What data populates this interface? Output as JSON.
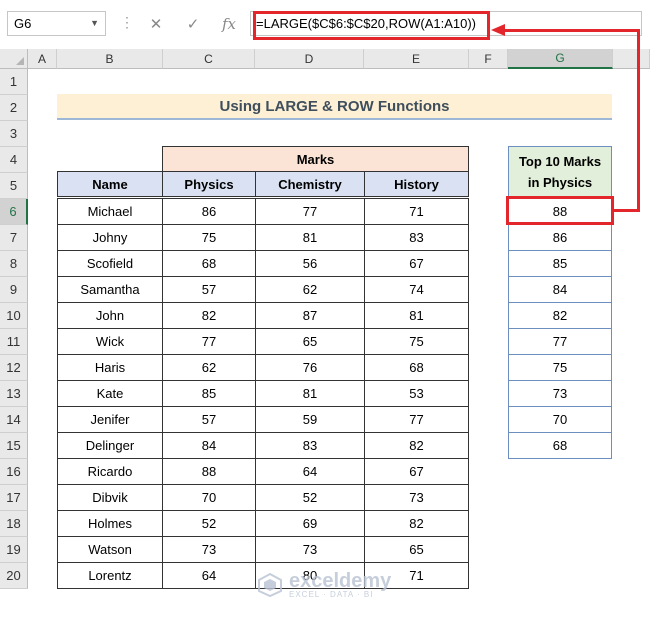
{
  "formula_bar": {
    "name_box": "G6",
    "cancel_icon": "✕",
    "enter_icon": "✓",
    "fx_label": "fx",
    "formula": "=LARGE($C$6:$C$20,ROW(A1:A10))"
  },
  "columns": [
    "A",
    "B",
    "C",
    "D",
    "E",
    "F",
    "G"
  ],
  "rows": [
    "1",
    "2",
    "3",
    "4",
    "5",
    "6",
    "7",
    "8",
    "9",
    "10",
    "11",
    "12",
    "13",
    "14",
    "15",
    "16",
    "17",
    "18",
    "19",
    "20"
  ],
  "selected": {
    "column": "G",
    "row": "6"
  },
  "title": "Using LARGE & ROW Functions",
  "table": {
    "group_header": "Marks",
    "headers": [
      "Name",
      "Physics",
      "Chemistry",
      "History"
    ],
    "rows": [
      [
        "Michael",
        "86",
        "77",
        "71"
      ],
      [
        "Johny",
        "75",
        "81",
        "83"
      ],
      [
        "Scofield",
        "68",
        "56",
        "67"
      ],
      [
        "Samantha",
        "57",
        "62",
        "74"
      ],
      [
        "John",
        "82",
        "87",
        "81"
      ],
      [
        "Wick",
        "77",
        "65",
        "75"
      ],
      [
        "Haris",
        "62",
        "76",
        "68"
      ],
      [
        "Kate",
        "85",
        "81",
        "53"
      ],
      [
        "Jenifer",
        "57",
        "59",
        "77"
      ],
      [
        "Delinger",
        "84",
        "83",
        "82"
      ],
      [
        "Ricardo",
        "88",
        "64",
        "67"
      ],
      [
        "Dibvik",
        "70",
        "52",
        "73"
      ],
      [
        "Holmes",
        "52",
        "69",
        "82"
      ],
      [
        "Watson",
        "73",
        "73",
        "65"
      ],
      [
        "Lorentz",
        "64",
        "80",
        "71"
      ]
    ]
  },
  "top10": {
    "header_line1": "Top 10 Marks",
    "header_line2": "in Physics",
    "values": [
      "88",
      "86",
      "85",
      "84",
      "82",
      "77",
      "75",
      "73",
      "70",
      "68"
    ]
  },
  "watermark": {
    "name": "exceldemy",
    "tagline": "EXCEL · DATA · BI"
  },
  "colors": {
    "accent_red": "#e3262b",
    "excel_green": "#217346"
  }
}
